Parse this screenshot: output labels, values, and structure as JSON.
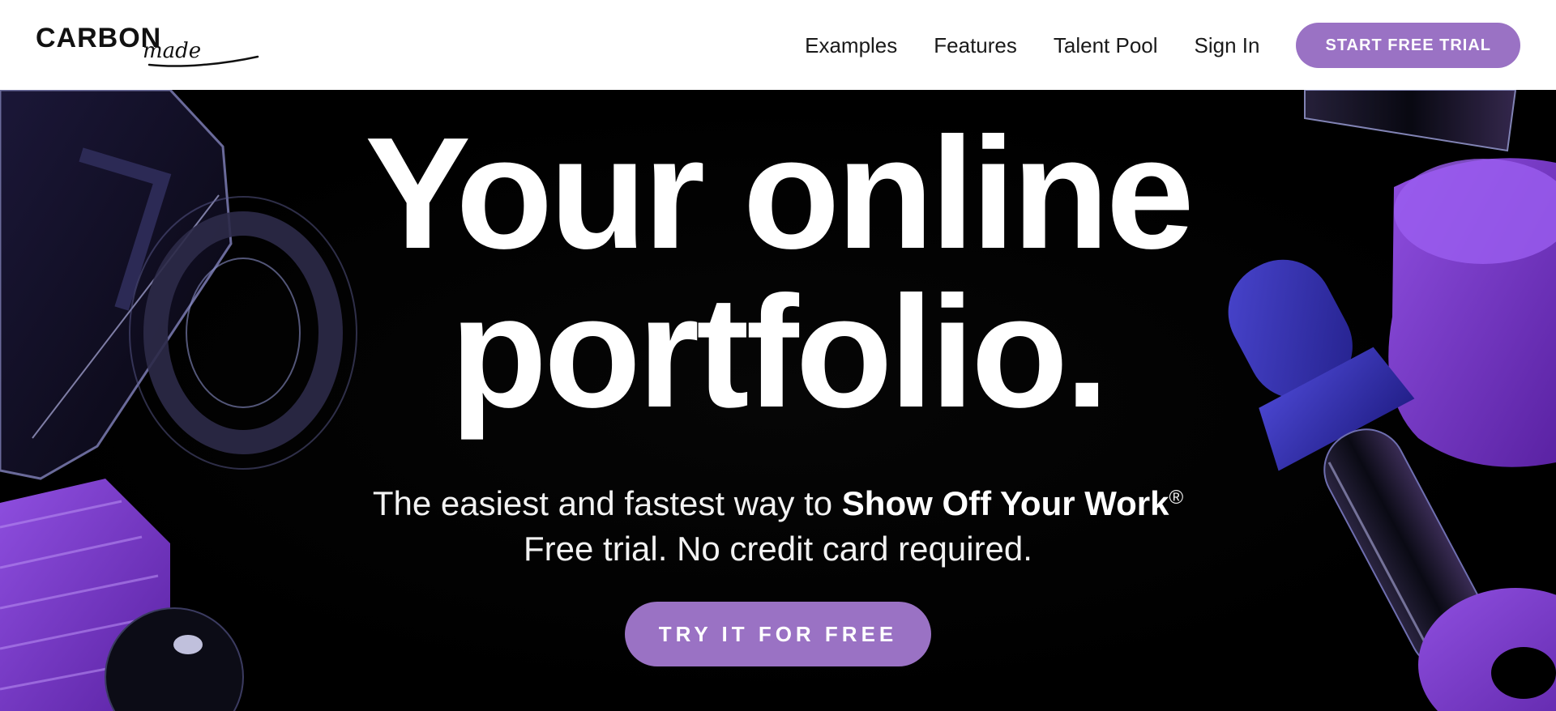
{
  "brand": {
    "logo_word": "CARBON",
    "logo_script": "made"
  },
  "nav": {
    "items": [
      {
        "label": "Examples"
      },
      {
        "label": "Features"
      },
      {
        "label": "Talent Pool"
      },
      {
        "label": "Sign In"
      }
    ],
    "cta_label": "START FREE TRIAL"
  },
  "hero": {
    "headline_line1": "Your online",
    "headline_line2": "portfolio.",
    "subline_prefix": "The easiest and fastest way to ",
    "subline_emphasis": "Show Off Your Work",
    "subline_mark": "®",
    "subline_second": "Free trial. No credit card required.",
    "cta_label": "TRY IT FOR FREE"
  },
  "colors": {
    "accent_purple": "#9a72c4",
    "deco_purple": "#7b3fc4",
    "deco_blue": "#3a36b8",
    "hero_background": "#000000",
    "header_background": "#ffffff"
  }
}
